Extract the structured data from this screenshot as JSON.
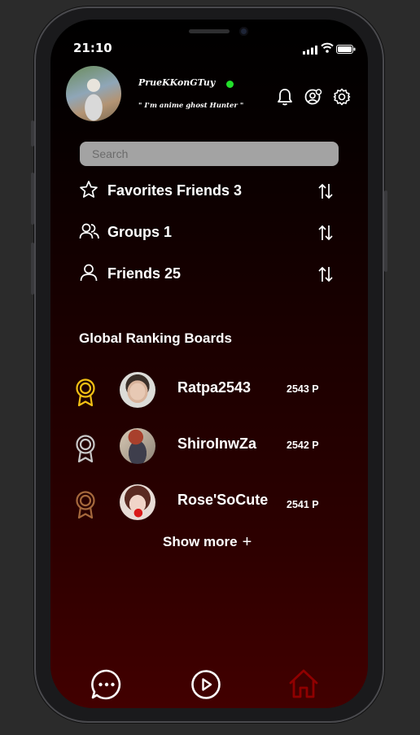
{
  "status": {
    "time": "21:10"
  },
  "profile": {
    "username": "PrueKKonGTuy",
    "bio": "\" I'm anime ghost Hunter \"",
    "online_color": "#22e02a"
  },
  "header_icons": [
    "bell-icon",
    "account-settings-icon",
    "gear-icon"
  ],
  "search": {
    "placeholder": "Search"
  },
  "lists": [
    {
      "label": "Favorites Friends 3",
      "icon": "star-icon"
    },
    {
      "label": "Groups 1",
      "icon": "users-icon"
    },
    {
      "label": "Friends 25",
      "icon": "user-icon"
    }
  ],
  "ranking": {
    "title": "Global Ranking Boards",
    "entries": [
      {
        "name": "Ratpa2543",
        "points": "2543 P",
        "medal_color": "#f2c014"
      },
      {
        "name": "ShiroInwZa",
        "points": "2542 P",
        "medal_color": "#c9c9c9"
      },
      {
        "name": "Rose'SoCute",
        "points": "2541 P",
        "medal_color": "#a5683c"
      }
    ],
    "show_more": "Show more",
    "show_more_symbol": "+"
  },
  "bottom_nav": [
    {
      "icon": "chat-icon",
      "active": false
    },
    {
      "icon": "play-icon",
      "active": false
    },
    {
      "icon": "home-icon",
      "active": true,
      "color": "#8f0000"
    }
  ]
}
